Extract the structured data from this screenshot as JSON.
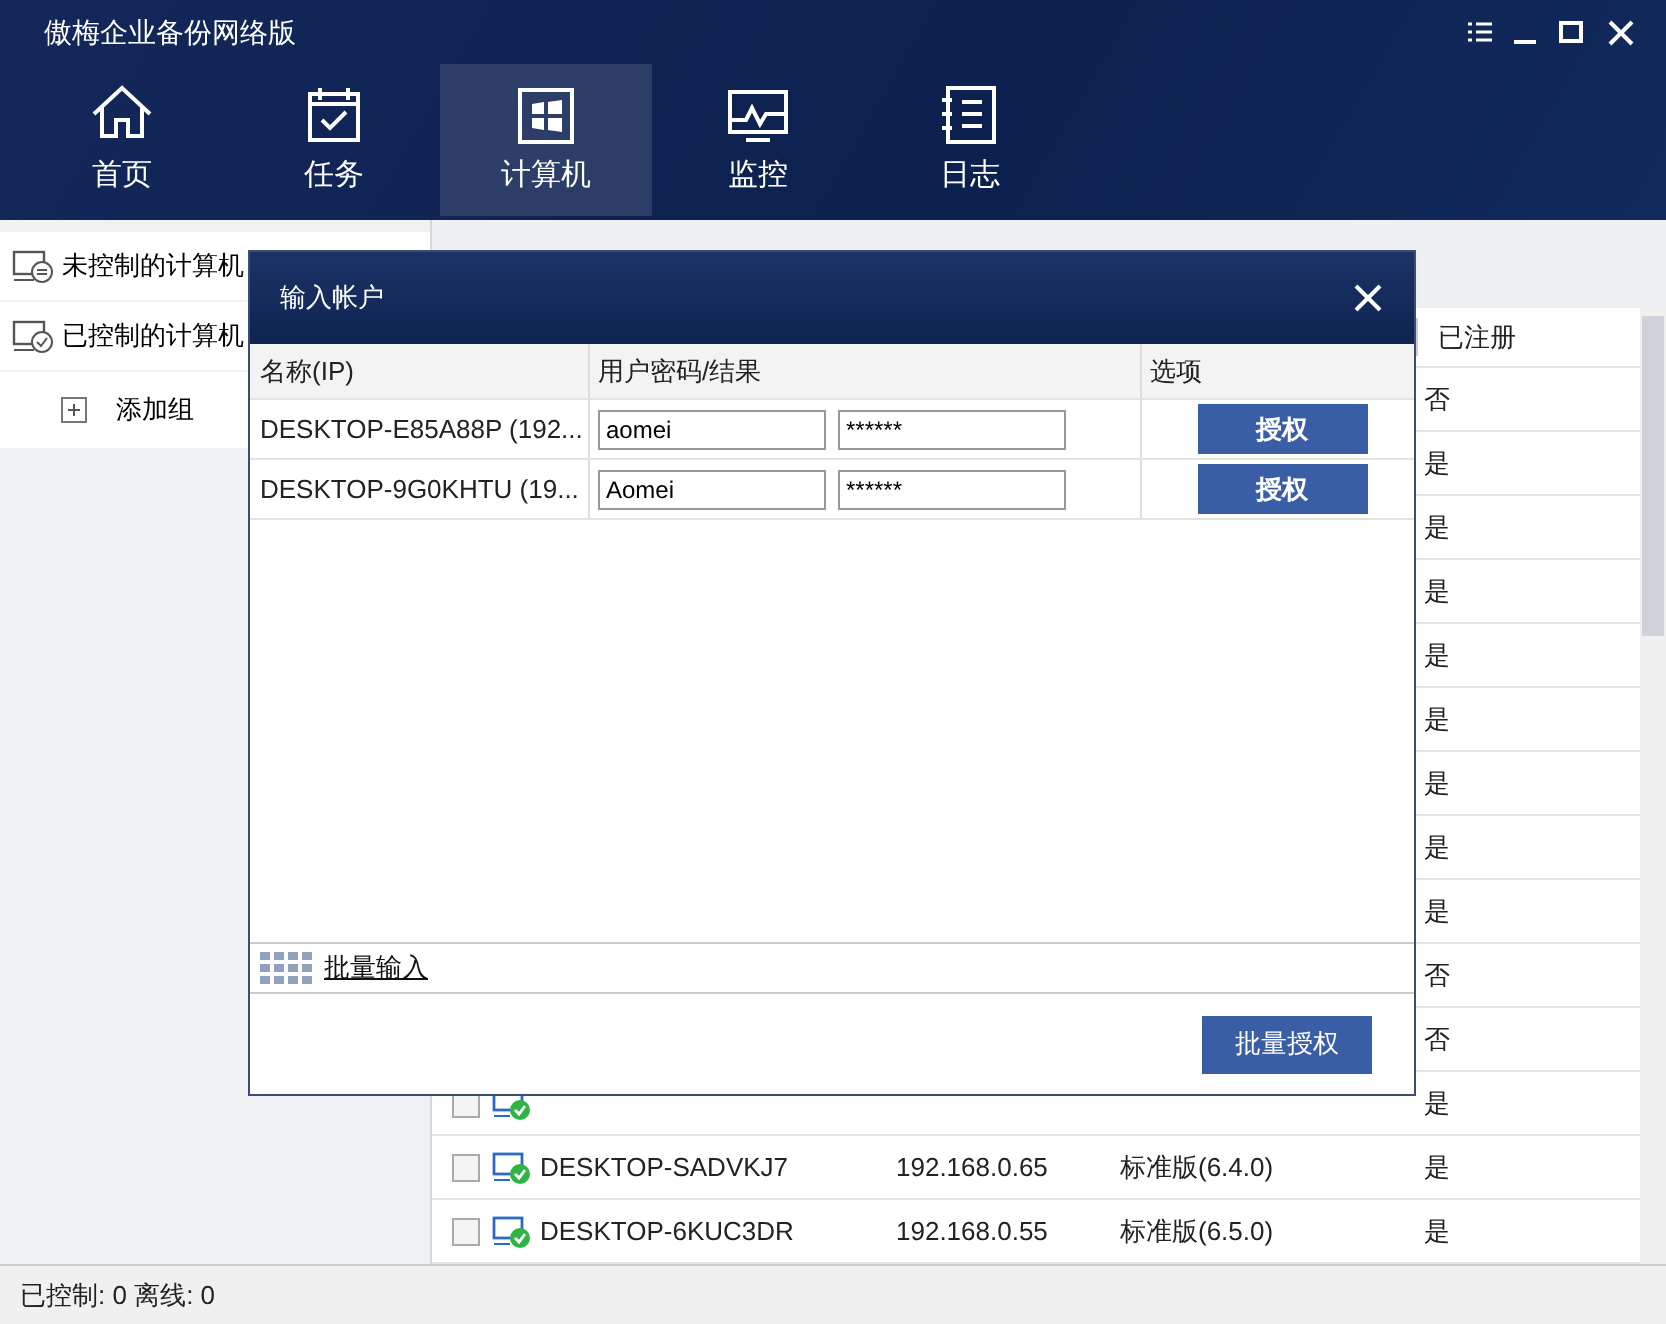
{
  "window": {
    "title": "傲梅企业备份网络版"
  },
  "nav_tabs": [
    {
      "label": "首页",
      "kind": "home",
      "selected": false
    },
    {
      "label": "任务",
      "kind": "task",
      "selected": false
    },
    {
      "label": "计算机",
      "kind": "computer",
      "selected": true
    },
    {
      "label": "监控",
      "kind": "monitor",
      "selected": false
    },
    {
      "label": "日志",
      "kind": "log",
      "selected": false
    }
  ],
  "sidebar": {
    "items": [
      {
        "label": "未控制的计算机",
        "kind": "uncontrolled"
      },
      {
        "label": "已控制的计算机",
        "kind": "controlled"
      },
      {
        "label": "添加组",
        "kind": "add"
      }
    ]
  },
  "table": {
    "columns": [
      "已注册"
    ],
    "rows": [
      {
        "kind": "covered",
        "registered": "否"
      },
      {
        "kind": "covered",
        "registered": "是"
      },
      {
        "kind": "covered",
        "registered": "是"
      },
      {
        "kind": "covered",
        "registered": "是"
      },
      {
        "kind": "covered",
        "registered": "是"
      },
      {
        "kind": "covered",
        "registered": "是"
      },
      {
        "kind": "covered",
        "registered": "是"
      },
      {
        "kind": "covered",
        "registered": "是"
      },
      {
        "kind": "covered",
        "registered": "是"
      },
      {
        "kind": "covered",
        "registered": "否"
      },
      {
        "kind": "covered",
        "registered": "否"
      },
      {
        "kind": "partial",
        "checked": false,
        "registered": "是"
      },
      {
        "kind": "full",
        "checked": false,
        "name": "DESKTOP-SADVKJ7",
        "ip": "192.168.0.65",
        "edition": "标准版(6.4.0)",
        "registered": "是"
      },
      {
        "kind": "full",
        "checked": false,
        "name": "DESKTOP-6KUC3DR",
        "ip": "192.168.0.55",
        "edition": "标准版(6.5.0)",
        "registered": "是"
      }
    ]
  },
  "dialog": {
    "title": "输入帐户",
    "columns": [
      "名称(IP)",
      "用户密码/结果",
      "选项"
    ],
    "rows": [
      {
        "name": "DESKTOP-E85A88P (192...",
        "user": "aomei",
        "password": "******",
        "button": "授权"
      },
      {
        "name": "DESKTOP-9G0KHTU (19...",
        "user": "Aomei",
        "password": "******",
        "button": "授权"
      }
    ],
    "batch_input_link": "批量输入",
    "batch_button": "批量授权"
  },
  "status_bar": "已控制: 0 离线: 0"
}
